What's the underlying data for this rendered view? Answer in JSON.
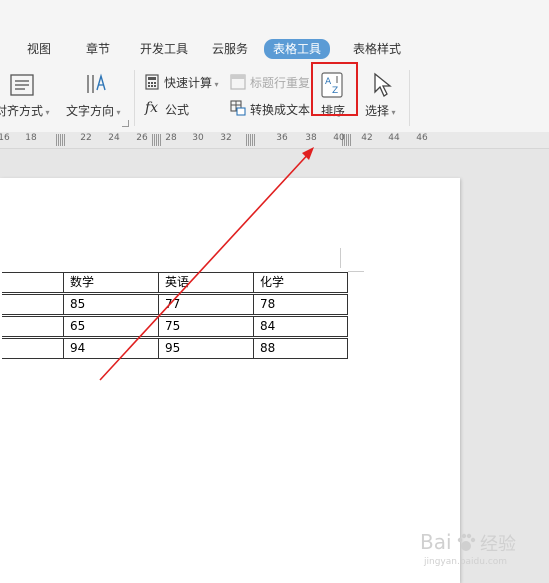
{
  "tabs": [
    {
      "label": "视图",
      "active": false
    },
    {
      "label": "章节",
      "active": false
    },
    {
      "label": "开发工具",
      "active": false
    },
    {
      "label": "云服务",
      "active": false
    },
    {
      "label": "表格工具",
      "active": true
    },
    {
      "label": "表格样式",
      "active": false
    }
  ],
  "ribbon": {
    "align_label": "对齐方式",
    "text_direction_label": "文字方向",
    "quick_calc_label": "快速计算",
    "repeat_header_label": "标题行重复",
    "formula_label": "公式",
    "formula_prefix": "fx",
    "convert_label": "转换成文本",
    "sort_label": "排序",
    "select_label": "选择"
  },
  "ruler": {
    "ticks": [
      "16",
      "18",
      "22",
      "24",
      "26",
      "28",
      "30",
      "32",
      "36",
      "38",
      "40",
      "42",
      "44",
      "46"
    ]
  },
  "table": {
    "header": [
      "",
      "数学",
      "英语",
      "化学"
    ],
    "rows": [
      [
        "",
        "85",
        "77",
        "78"
      ],
      [
        "",
        "65",
        "75",
        "84"
      ],
      [
        "",
        "94",
        "95",
        "88"
      ]
    ]
  },
  "colors": {
    "accent": "#5b9bd5",
    "highlight": "#e02020",
    "arrow": "#e02020"
  },
  "watermark": {
    "brand": "Bai",
    "brand2": "经验",
    "url": "jingyan.baidu.com"
  }
}
